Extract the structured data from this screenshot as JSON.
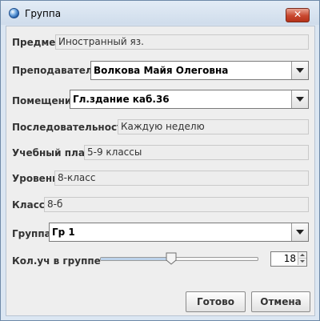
{
  "window": {
    "title": "Группа",
    "close_label": "✕"
  },
  "form": {
    "subject": {
      "label": "Предмет",
      "value": "Иностранный яз."
    },
    "teacher": {
      "label": "Преподаватель",
      "value": "Волкова Майя Олеговна"
    },
    "room": {
      "label": "Помещение",
      "value": "Гл.здание каб.36"
    },
    "sequence": {
      "label": "Последовательность",
      "value": "Каждую неделю"
    },
    "curriculum": {
      "label": "Учебный план",
      "value": "5-9 классы"
    },
    "level": {
      "label": "Уровень",
      "value": "8-класс"
    },
    "class": {
      "label": "Класс",
      "value": "8-б"
    },
    "group": {
      "label": "Группа",
      "value": "Гр 1"
    },
    "count": {
      "label": "Кол.уч в группе",
      "value": "18",
      "slider_fraction": 0.45
    }
  },
  "buttons": {
    "ok": "Готово",
    "cancel": "Отмена"
  }
}
